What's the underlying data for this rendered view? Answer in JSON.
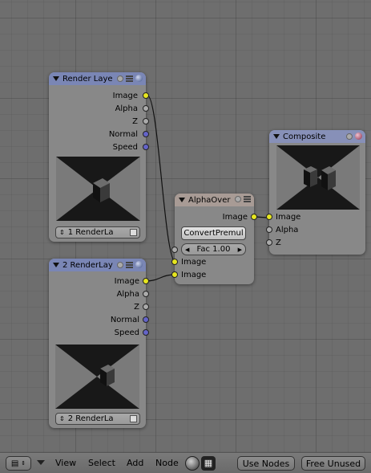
{
  "nodes": {
    "render_layers_1": {
      "title": "Render Laye",
      "outputs": [
        "Image",
        "Alpha",
        "Z",
        "Normal",
        "Speed"
      ],
      "layer_select": "1 RenderLa"
    },
    "render_layers_2": {
      "title": "2 RenderLay",
      "outputs": [
        "Image",
        "Alpha",
        "Z",
        "Normal",
        "Speed"
      ],
      "layer_select": "2 RenderLa"
    },
    "alpha_over": {
      "title": "AlphaOver",
      "output": "Image",
      "convert_button": "ConvertPremul",
      "fac_label": "Fac 1.00",
      "inputs": [
        "Image",
        "Image"
      ]
    },
    "composite": {
      "title": "Composite",
      "inputs": [
        "Image",
        "Alpha",
        "Z"
      ]
    }
  },
  "footer": {
    "menus": [
      "View",
      "Select",
      "Add",
      "Node"
    ],
    "use_nodes": "Use Nodes",
    "free_unused": "Free Unused"
  },
  "colors": {
    "header_render": "#7a86b5",
    "header_converter": "#a89b95",
    "header_output": "#8790b8",
    "socket_color": "#e6e620",
    "socket_value": "#aaaaaa",
    "socket_vector": "#6464c8"
  },
  "icons": {
    "header": [
      "circle-plus-icon",
      "node-options-icon",
      "render-sphere-icon"
    ],
    "footer": [
      "editor-type-icon",
      "triangle-menu-icon",
      "sphere-icon",
      "checker-icon"
    ]
  }
}
